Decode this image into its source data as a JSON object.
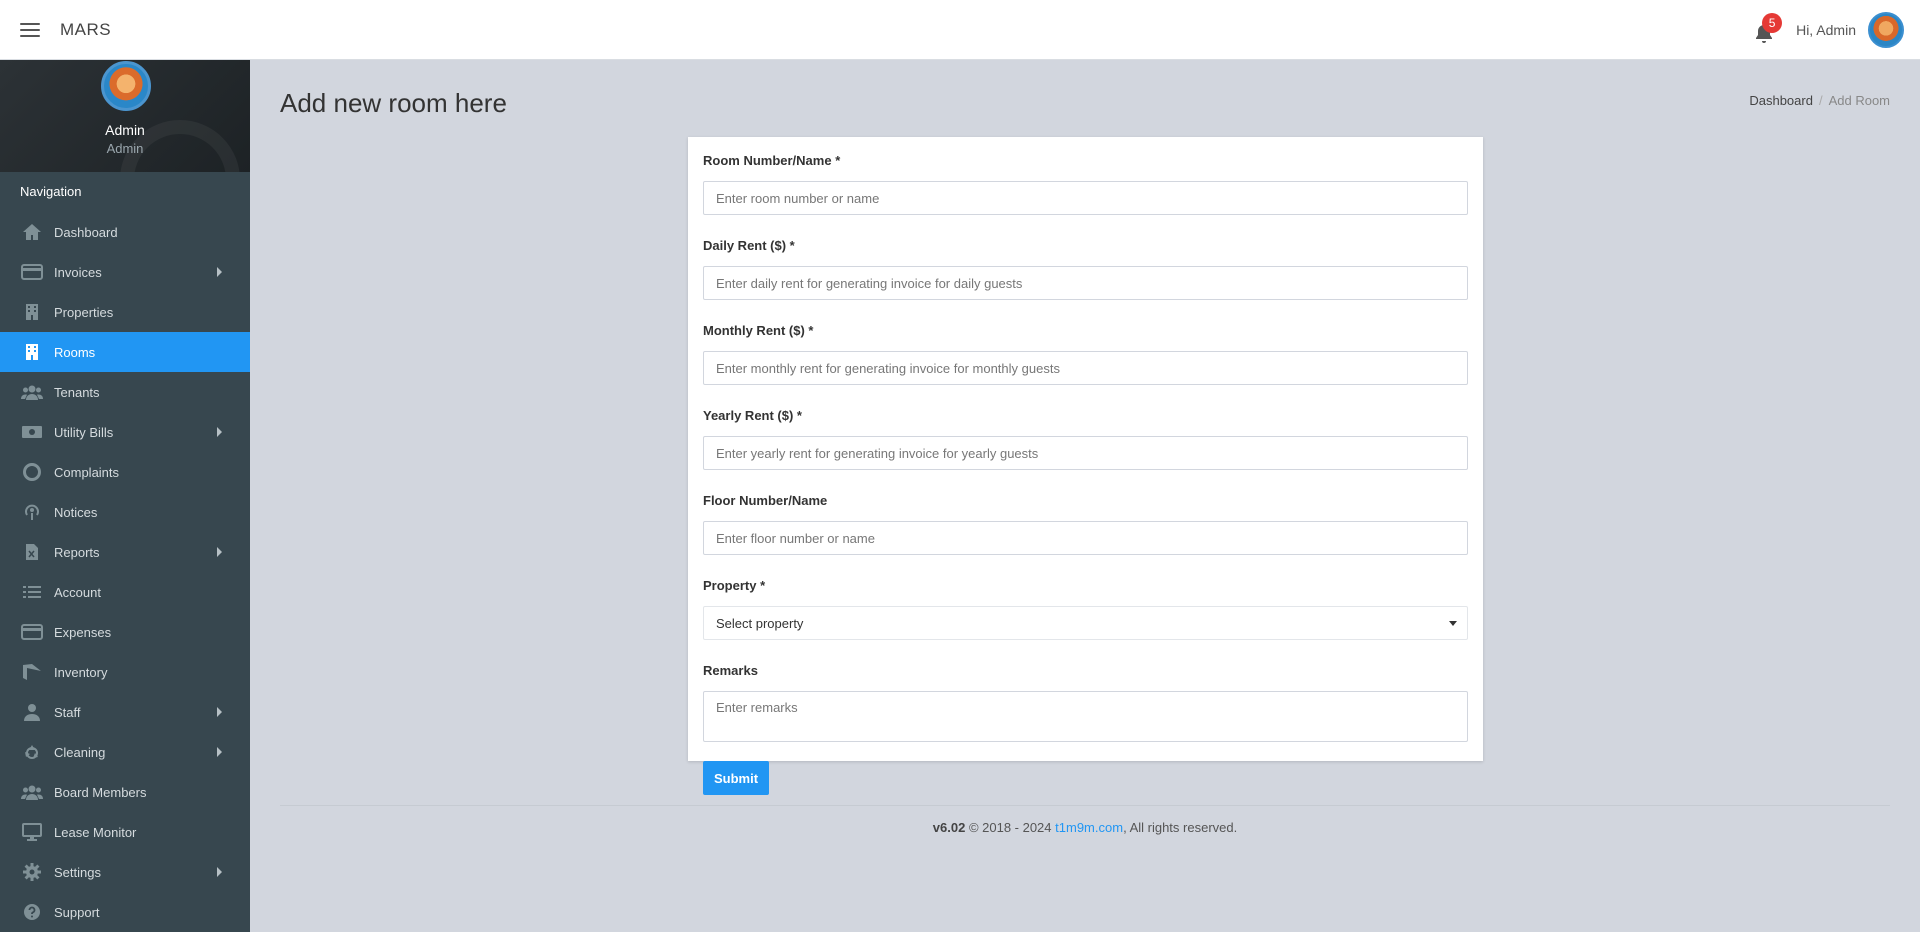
{
  "header": {
    "brand": "MARS",
    "notifications": "5",
    "greeting": "Hi, Admin"
  },
  "sidebar": {
    "user_name": "Admin",
    "user_role": "Admin",
    "nav_title": "Navigation",
    "items": [
      {
        "label": "Dashboard",
        "icon": "home-icon"
      },
      {
        "label": "Invoices",
        "icon": "credit-card-icon",
        "submenu": true
      },
      {
        "label": "Properties",
        "icon": "building-icon"
      },
      {
        "label": "Rooms",
        "icon": "building-icon",
        "active": true
      },
      {
        "label": "Tenants",
        "icon": "users-icon"
      },
      {
        "label": "Utility Bills",
        "icon": "money-bill-icon",
        "submenu": true
      },
      {
        "label": "Complaints",
        "icon": "lifebuoy-icon"
      },
      {
        "label": "Notices",
        "icon": "podcast-icon"
      },
      {
        "label": "Reports",
        "icon": "file-excel-icon",
        "submenu": true
      },
      {
        "label": "Account",
        "icon": "list-icon"
      },
      {
        "label": "Expenses",
        "icon": "credit-card-icon"
      },
      {
        "label": "Inventory",
        "icon": "tag-icon"
      },
      {
        "label": "Staff",
        "icon": "user-icon",
        "submenu": true
      },
      {
        "label": "Cleaning",
        "icon": "recycle-icon",
        "submenu": true
      },
      {
        "label": "Board Members",
        "icon": "users-icon"
      },
      {
        "label": "Lease Monitor",
        "icon": "desktop-icon"
      },
      {
        "label": "Settings",
        "icon": "gear-icon",
        "submenu": true
      },
      {
        "label": "Support",
        "icon": "question-circle-icon"
      }
    ]
  },
  "page": {
    "title": "Add new room here",
    "breadcrumb": [
      "Dashboard",
      "Add Room"
    ]
  },
  "form": {
    "room_label": "Room Number/Name *",
    "room_placeholder": "Enter room number or name",
    "daily_label": "Daily Rent ($) *",
    "daily_placeholder": "Enter daily rent for generating invoice for daily guests",
    "monthly_label": "Monthly Rent ($) *",
    "monthly_placeholder": "Enter monthly rent for generating invoice for monthly guests",
    "yearly_label": "Yearly Rent ($) *",
    "yearly_placeholder": "Enter yearly rent for generating invoice for yearly guests",
    "floor_label": "Floor Number/Name",
    "floor_placeholder": "Enter floor number or name",
    "property_label": "Property *",
    "property_selected": "Select property",
    "remarks_label": "Remarks",
    "remarks_placeholder": "Enter remarks",
    "submit_label": "Submit"
  },
  "footer": {
    "version": "v6.02",
    "copyright": "© 2018 - 2024",
    "link": "t1m9m.com",
    "rights": ", All rights reserved."
  },
  "colors": {
    "accent": "#2196f3",
    "sidebar": "#37474f",
    "background": "#d2d6de",
    "badge": "#e53935"
  }
}
